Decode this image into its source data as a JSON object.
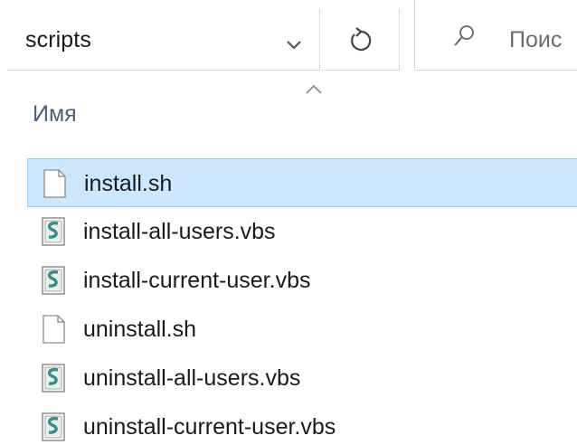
{
  "address": {
    "current_folder": "scripts"
  },
  "search": {
    "placeholder": "Поис"
  },
  "columns": {
    "name_header": "Имя"
  },
  "files": [
    {
      "name": "install.sh",
      "type": "sh",
      "selected": true
    },
    {
      "name": "install-all-users.vbs",
      "type": "vbs",
      "selected": false
    },
    {
      "name": "install-current-user.vbs",
      "type": "vbs",
      "selected": false
    },
    {
      "name": "uninstall.sh",
      "type": "sh",
      "selected": false
    },
    {
      "name": "uninstall-all-users.vbs",
      "type": "vbs",
      "selected": false
    },
    {
      "name": "uninstall-current-user.vbs",
      "type": "vbs",
      "selected": false
    }
  ],
  "colors": {
    "selection_bg": "#cce8ff",
    "selection_border": "#99d1ff",
    "header_text": "#4c607a"
  }
}
